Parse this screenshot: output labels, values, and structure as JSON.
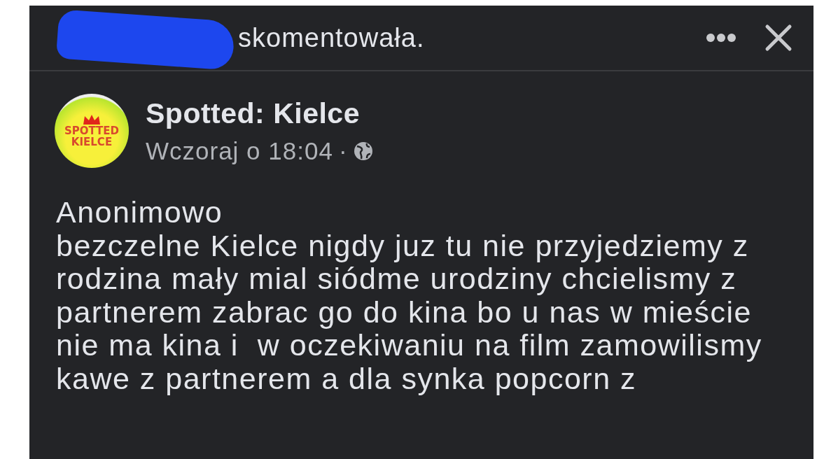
{
  "header": {
    "text": "skomentowała.",
    "redacted": true
  },
  "post": {
    "page_name": "Spotted: Kielce",
    "avatar_text": [
      "SPOTTED",
      "KIELCE"
    ],
    "time": "Wczoraj o 18:04",
    "separator": "·",
    "body_lines": [
      "Anonimowo",
      "bezczelne Kielce nigdy juz tu nie przyjedziemy z",
      "rodzina mały mial siódme urodziny chcielismy z",
      "partnerem zabrac go do kina bo u nas w mieście",
      "nie ma kina i  w oczekiwaniu na film zamowilismy",
      "kawe z partnerem a dla synka popcorn z"
    ]
  }
}
